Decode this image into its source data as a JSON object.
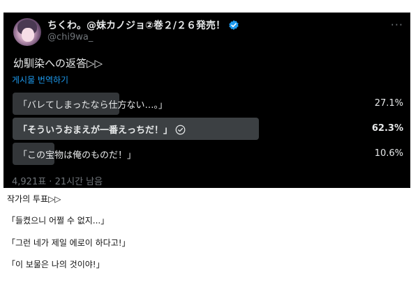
{
  "tweet": {
    "display_name": "ちくわ。@妹カノジョ②巻２/２６発売！",
    "handle": "@chi9wa_",
    "more_label": "···",
    "text": "幼馴染への返答▷▷",
    "translate_label": "게시물 번역하기",
    "poll": {
      "options": [
        {
          "label": "「バレてしまったなら仕方ない…。」",
          "percent_label": "27.1%",
          "percent": 27.1,
          "winner": false
        },
        {
          "label": "「そういうおまえが一番えっちだ！」",
          "percent_label": "62.3%",
          "percent": 62.3,
          "winner": true
        },
        {
          "label": "「この宝物は俺のものだ！」",
          "percent_label": "10.6%",
          "percent": 10.6,
          "winner": false
        }
      ],
      "footer": "4,921표 · 21시간 남음"
    }
  },
  "colors": {
    "background": "#000000",
    "bar": "#333639",
    "bar_winner": "#3c4043",
    "link": "#1d9bf0",
    "verified": "#1d9bf0",
    "muted": "#71767b"
  },
  "caption": {
    "title": "작가의 투표▷▷",
    "lines": [
      "「들켰으니 어쩔 수 없지...」",
      "「그런 네가 제일 에로이 하다고!」",
      "「이 보물은 나의 것이야!」"
    ]
  }
}
